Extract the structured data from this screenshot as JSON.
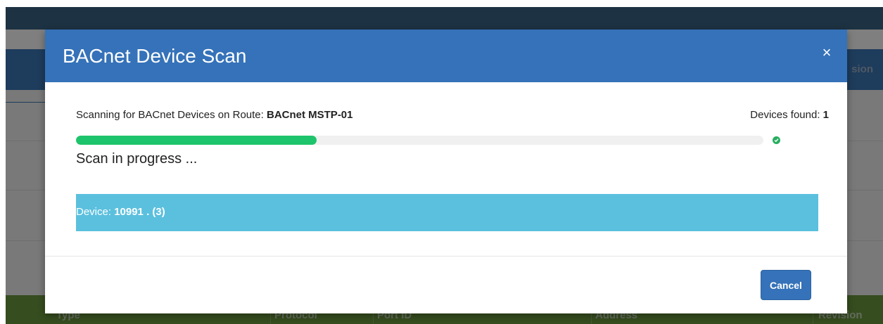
{
  "background": {
    "header_right_text": "sion",
    "footer_columns": [
      "Type",
      "Protocol",
      "Port ID",
      "Address",
      "Revision"
    ]
  },
  "modal": {
    "title": "BACnet Device Scan",
    "close_glyph": "×",
    "scan_prefix": "Scanning for BACnet Devices on Route: ",
    "route_name": "BACnet MSTP-01",
    "devices_found_label": "Devices found: ",
    "devices_found_count": "1",
    "progress": 0.35,
    "progress_color": "#1ec46b",
    "status_text": "Scan in progress ...",
    "device": {
      "label": "Device: ",
      "value": "10991 . (3)"
    },
    "cancel_label": "Cancel"
  },
  "colors": {
    "header": "#3572b9",
    "device_row": "#5bc0de",
    "done_indicator": "#27ae60"
  },
  "icons": {
    "close": "close-icon",
    "done": "check-circle-icon"
  }
}
